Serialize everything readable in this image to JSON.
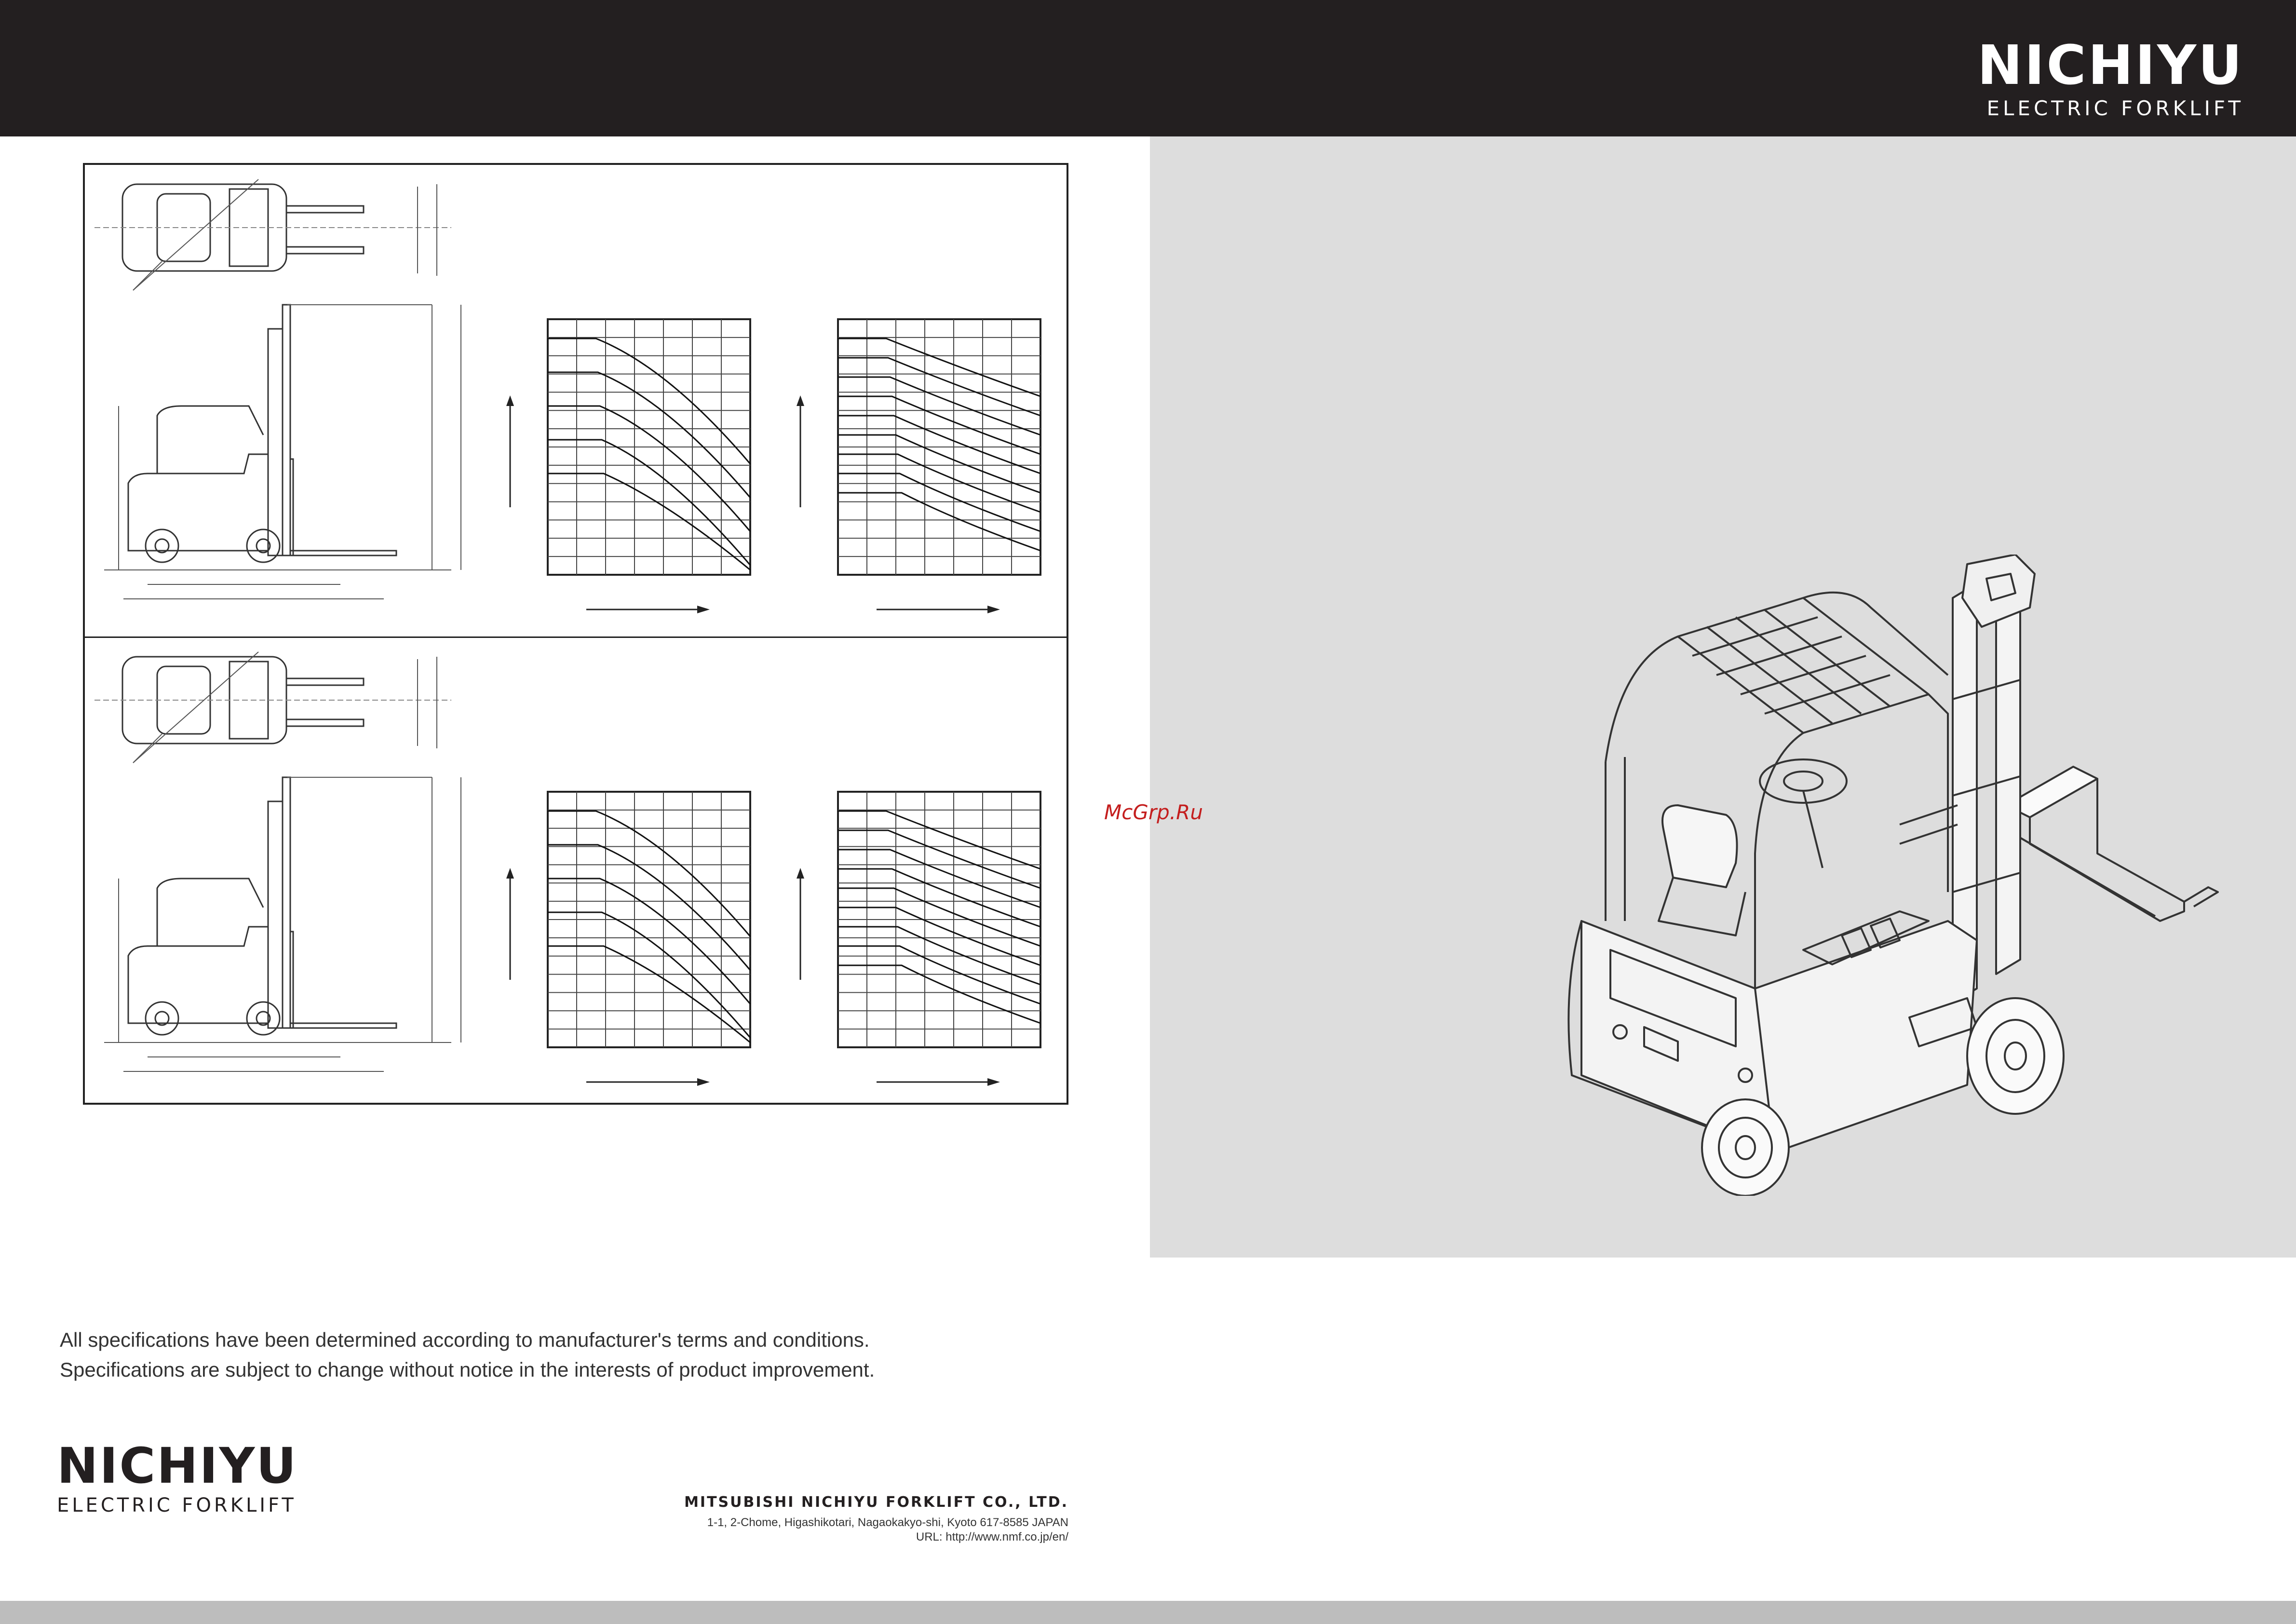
{
  "header": {
    "brand_name": "NICHIYU",
    "brand_sub": "ELECTRIC FORKLIFT"
  },
  "watermark": "McGrp.Ru",
  "notes": {
    "line1": "All specifications have been determined according to manufacturer's terms and conditions.",
    "line2": "Specifications are subject to change without notice in the interests of product improvement."
  },
  "footer": {
    "brand_name": "NICHIYU",
    "brand_sub": "ELECTRIC FORKLIFT",
    "company_name": "MITSUBISHI NICHIYU FORKLIFT CO., LTD.",
    "address": "1-1, 2-Chome, Higashikotari, Nagaokakyo-shi, Kyoto 617-8585 JAPAN",
    "url": "URL: http://www.nmf.co.jp/en/"
  },
  "colors": {
    "header_bg": "#231f20",
    "panel_bg": "#dddddd",
    "watermark": "#c41e1e",
    "bottom_bar": "#bdbdbd"
  },
  "icons": [
    "forklift-illustration",
    "forklift-top-view",
    "forklift-side-view",
    "load-chart-grid",
    "up-arrow-icon",
    "right-arrow-icon"
  ]
}
